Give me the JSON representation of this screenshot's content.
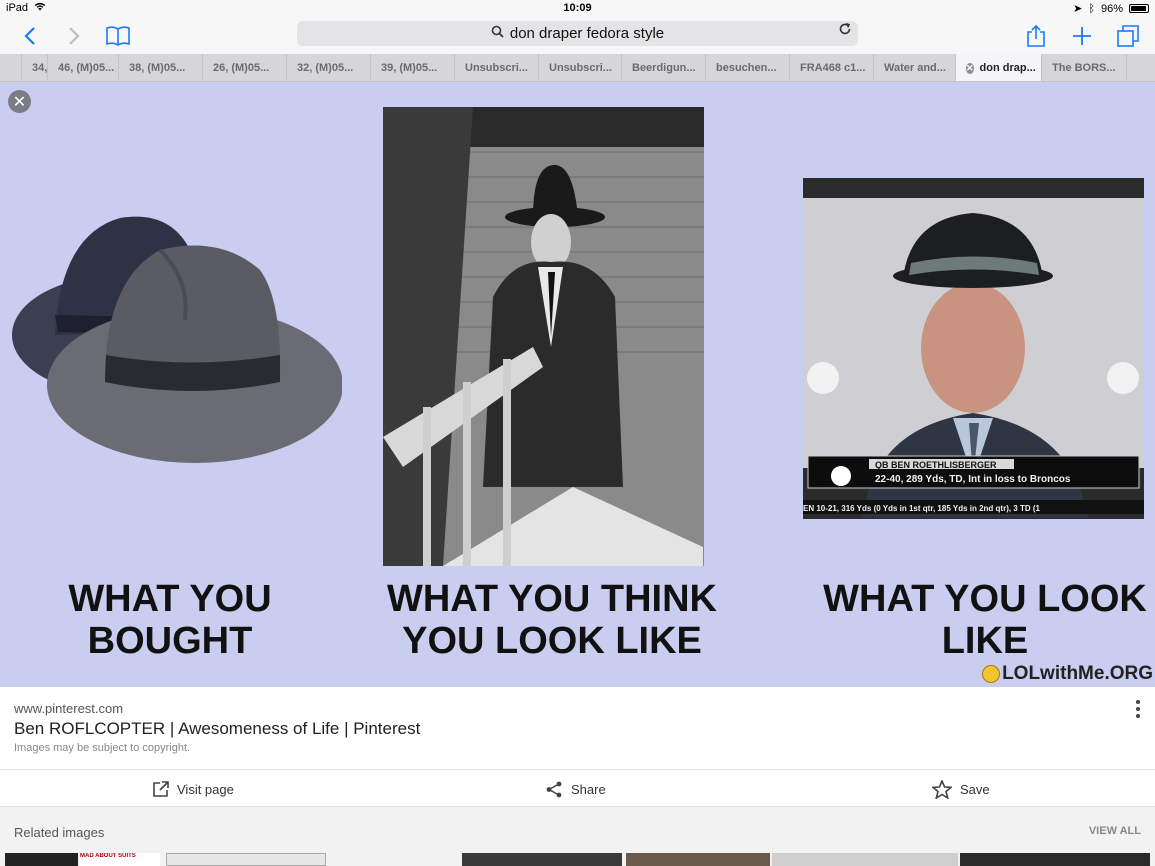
{
  "status_bar": {
    "device": "iPad",
    "time": "10:09",
    "battery": "96%"
  },
  "address": {
    "query": "don draper fedora style"
  },
  "tabs": [
    {
      "label": "",
      "active": false
    },
    {
      "label": "34,",
      "active": false
    },
    {
      "label": "46, (M)05...",
      "active": false
    },
    {
      "label": "38, (M)05...",
      "active": false
    },
    {
      "label": "26, (M)05...",
      "active": false
    },
    {
      "label": "32, (M)05...",
      "active": false
    },
    {
      "label": "39, (M)05...",
      "active": false
    },
    {
      "label": "Unsubscri...",
      "active": false
    },
    {
      "label": "Unsubscri...",
      "active": false
    },
    {
      "label": "Beerdigun...",
      "active": false
    },
    {
      "label": "besuchen...",
      "active": false
    },
    {
      "label": "FRA468 c1...",
      "active": false
    },
    {
      "label": "Water and...",
      "active": false
    },
    {
      "label": "don drap...",
      "active": true
    },
    {
      "label": "The BORS...",
      "active": false
    }
  ],
  "meme": {
    "caption_1": "WHAT YOU BOUGHT",
    "caption_2": "WHAT YOU THINK YOU LOOK LIKE",
    "caption_3": "WHAT YOU LOOK LIKE",
    "watermark": "LOLwithMe.ORG",
    "tv_name": "QB BEN ROETHLISBERGER",
    "tv_stats": "22-40, 289 Yds, TD, Int in loss to Broncos",
    "tv_ticker": "EN 10-21, 316 Yds (0 Yds in 1st qtr, 185 Yds in 2nd qtr), 3 TD (1"
  },
  "result": {
    "site": "www.pinterest.com",
    "title": "Ben ROFLCOPTER | Awesomeness of Life | Pinterest",
    "copyright": "Images may be subject to copyright."
  },
  "actions": {
    "visit": "Visit page",
    "share": "Share",
    "save": "Save"
  },
  "related": {
    "label": "Related images",
    "view_all": "VIEW ALL",
    "thumb_text": "MAD ABOUT SUITS"
  }
}
